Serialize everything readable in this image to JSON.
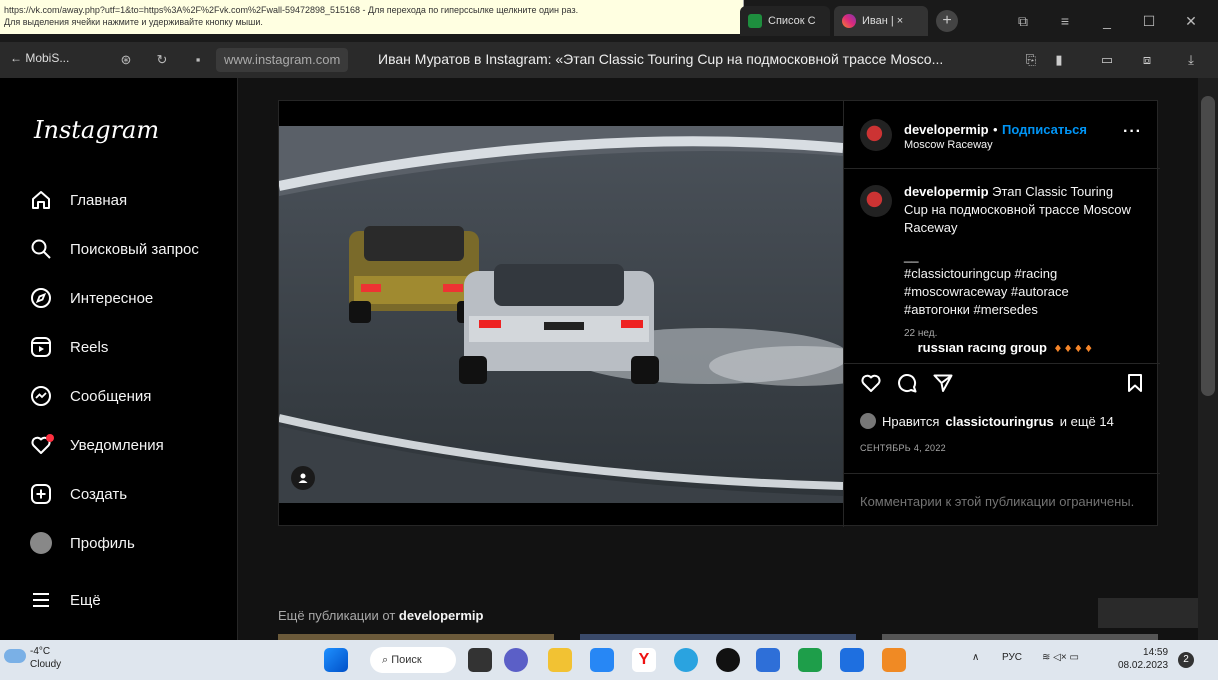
{
  "browser": {
    "tooltip": {
      "line1": "https://vk.com/away.php?utf=1&to=https%3A%2F%2Fvk.com%2Fwall-59472898_515168 - Для перехода по гиперссылке щелкните один раз.",
      "line2": "Для выделения ячейки нажмите и удерживайте кнопку мыши."
    },
    "tabs": [
      {
        "label": "Список С",
        "color": "#1e8e3e"
      },
      {
        "label": "Иван | ×",
        "color": "#e1306c"
      }
    ],
    "back_label": "← MobiS...",
    "url": "www.instagram.com",
    "page_title": "Иван Муратов в Instagram: «Этап Classic Touring Cup на подмосковной трассе Mosco..."
  },
  "sidebar": {
    "logo": "Instagram",
    "items": [
      {
        "label": "Главная",
        "icon": "home-icon"
      },
      {
        "label": "Поисковый запрос",
        "icon": "search-icon"
      },
      {
        "label": "Интересное",
        "icon": "compass-icon"
      },
      {
        "label": "Reels",
        "icon": "reels-icon"
      },
      {
        "label": "Сообщения",
        "icon": "messenger-icon"
      },
      {
        "label": "Уведомления",
        "icon": "heart-icon"
      },
      {
        "label": "Создать",
        "icon": "plus-square-icon"
      },
      {
        "label": "Профиль",
        "icon": "avatar"
      },
      {
        "label": "Ещё",
        "icon": "menu-icon"
      }
    ]
  },
  "post": {
    "author": "developermip",
    "dot": "•",
    "follow": "Подписаться",
    "location": "Moscow Raceway",
    "caption_text": "Этап Classic Touring Cup на подмосковной трассе Moscow Raceway",
    "caption_sep": "__",
    "hashtags": "#classictouringcup #racing #moscowraceway #autorace #автогонки #mersedes",
    "caption_time": "22 нед.",
    "next_comment": "russian racing group",
    "likes_prefix": "Нравится",
    "likes_user": "classictouringrus",
    "likes_suffix": "и ещё 14",
    "date": "СЕНТЯБРЬ 4, 2022",
    "comments_off": "Комментарии к этой публикации ограничены."
  },
  "more_posts": {
    "prefix": "Ещё публикации от",
    "user": "developermip"
  },
  "taskbar": {
    "temp": "-4°C",
    "weather": "Cloudy",
    "search": "Поиск",
    "lang": "РУС",
    "time": "14:59",
    "date": "08.02.2023"
  }
}
